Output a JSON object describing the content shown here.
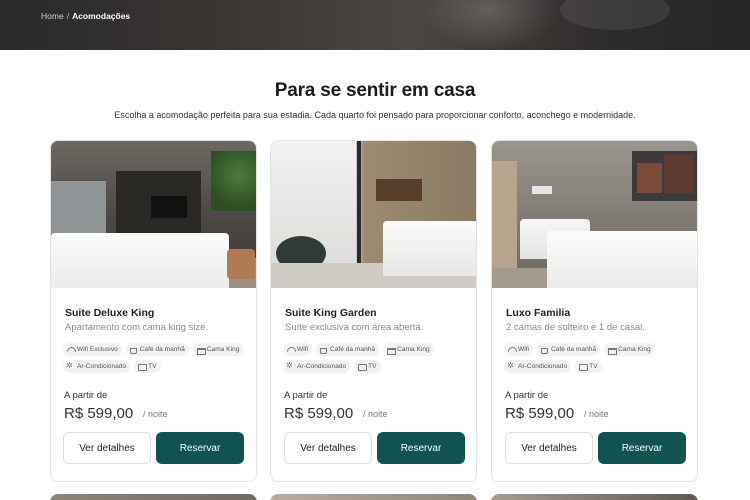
{
  "breadcrumb": {
    "home": "Home",
    "separator": "/",
    "current": "Acomodações"
  },
  "section": {
    "title": "Para se sentir em casa",
    "subtitle": "Escolha a acomodação perfeita para sua estadia. Cada quarto foi pensado para proporcionar conforto, aconchego e modernidade."
  },
  "colors": {
    "accent": "#0f5450",
    "pill_bg": "#f2f2f2"
  },
  "rooms": [
    {
      "name": "Suite Deluxe King",
      "description": "Apartamento com cama king size.",
      "amenities": [
        {
          "icon": "wifi-icon",
          "label": "Wifi Exclusivo"
        },
        {
          "icon": "coffee-icon",
          "label": "Café da manhã"
        },
        {
          "icon": "bed-icon",
          "label": "Cama King"
        },
        {
          "icon": "snowflake-icon",
          "label": "Ar-Condicionado"
        },
        {
          "icon": "tv-icon",
          "label": "TV"
        }
      ],
      "price_prefix": "A partir de",
      "price": "R$ 599,00",
      "price_suffix": "/ noite",
      "details_label": "Ver detalhes",
      "book_label": "Reservar"
    },
    {
      "name": "Suite King Garden",
      "description": "Suíte exclusiva com área aberta.",
      "amenities": [
        {
          "icon": "wifi-icon",
          "label": "Wifi"
        },
        {
          "icon": "coffee-icon",
          "label": "Café da manhã"
        },
        {
          "icon": "bed-icon",
          "label": "Cama King"
        },
        {
          "icon": "snowflake-icon",
          "label": "Ar-Condicionado"
        },
        {
          "icon": "tv-icon",
          "label": "TV"
        }
      ],
      "price_prefix": "A partir de",
      "price": "R$ 599,00",
      "price_suffix": "/ noite",
      "details_label": "Ver detalhes",
      "book_label": "Reservar"
    },
    {
      "name": "Luxo Familia",
      "description": "2 camas de solteiro e 1 de casal.",
      "amenities": [
        {
          "icon": "wifi-icon",
          "label": "Wifi"
        },
        {
          "icon": "coffee-icon",
          "label": "Café da manhã"
        },
        {
          "icon": "bed-icon",
          "label": "Cama King"
        },
        {
          "icon": "snowflake-icon",
          "label": "Ar-Condicionado"
        },
        {
          "icon": "tv-icon",
          "label": "TV"
        }
      ],
      "price_prefix": "A partir de",
      "price": "R$ 599,00",
      "price_suffix": "/ noite",
      "details_label": "Ver detalhes",
      "book_label": "Reservar"
    }
  ]
}
